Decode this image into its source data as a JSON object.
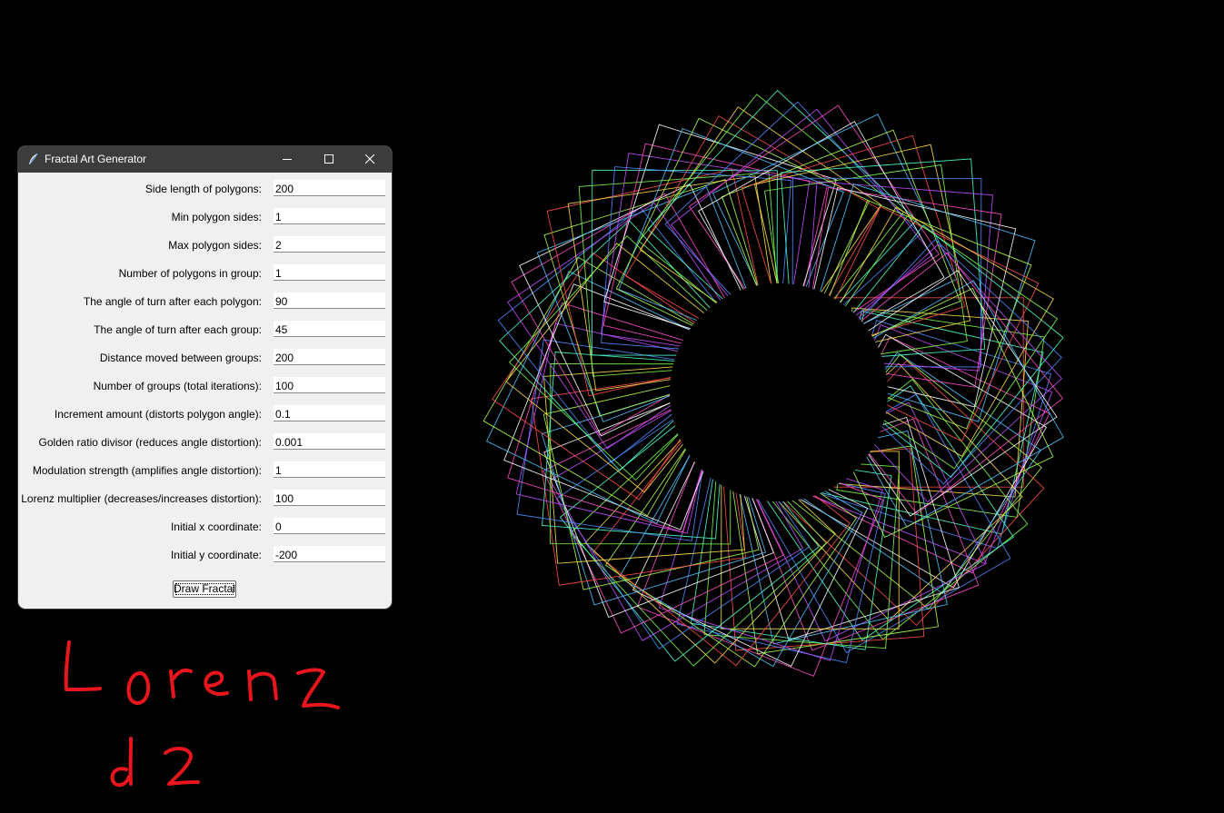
{
  "window": {
    "title": "Fractal Art Generator",
    "app_icon": "feather-icon",
    "controls": [
      "minimize-icon",
      "maximize-icon",
      "close-icon"
    ]
  },
  "form": {
    "fields": [
      {
        "label": "Side length of polygons:",
        "value": "200"
      },
      {
        "label": "Min polygon sides:",
        "value": "1"
      },
      {
        "label": "Max polygon sides:",
        "value": "2"
      },
      {
        "label": "Number of polygons in group:",
        "value": "1"
      },
      {
        "label": "The angle of turn after each polygon:",
        "value": "90"
      },
      {
        "label": "The angle of turn after each group:",
        "value": "45"
      },
      {
        "label": "Distance moved between groups:",
        "value": "200"
      },
      {
        "label": "Number of groups (total iterations):",
        "value": "100"
      },
      {
        "label": "Increment amount (distorts polygon angle):",
        "value": "0.1"
      },
      {
        "label": "Golden ratio divisor (reduces angle distortion):",
        "value": "0.001"
      },
      {
        "label": "Modulation strength (amplifies angle distortion):",
        "value": "1"
      },
      {
        "label": "Lorenz multiplier (decreases/increases distortion):",
        "value": "100"
      },
      {
        "label": "Initial x coordinate:",
        "value": "0"
      },
      {
        "label": "Initial y coordinate:",
        "value": "-200"
      }
    ],
    "draw_button": "Draw Fractal"
  },
  "handwritten_note": [
    "Lorenz",
    "d2"
  ],
  "colors": {
    "background": "#000000",
    "window_bg": "#f0f0f0",
    "titlebar_bg": "#3c3c3c",
    "handwriting": "#e8161c",
    "line_palette": [
      "#ff4d4d",
      "#ffe04d",
      "#7dff4d",
      "#4dffd2",
      "#4d8bff",
      "#c34dff",
      "#ff4dc8",
      "#ffffff",
      "#4dc3ff",
      "#b0ff4d"
    ]
  }
}
